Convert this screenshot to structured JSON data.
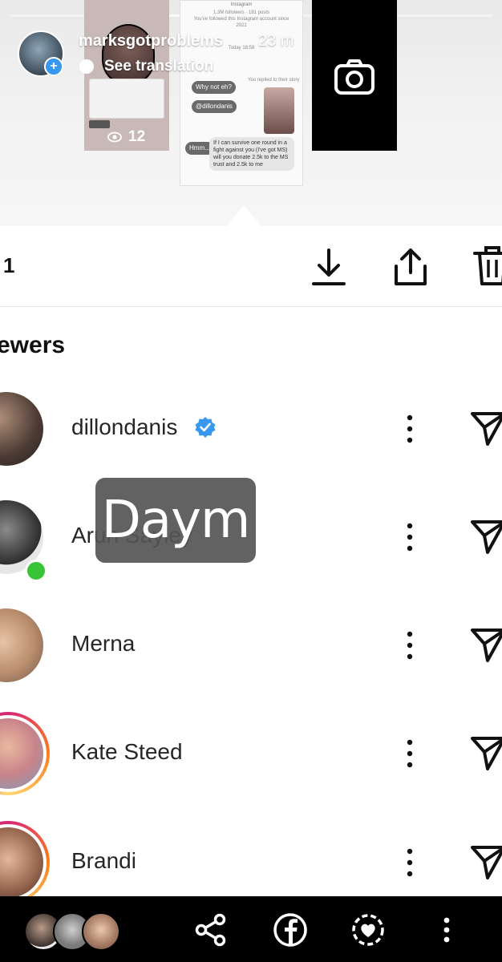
{
  "story": {
    "username": "marksgotproblems",
    "time": "23 m",
    "translate_label": "See translation",
    "view_count": "12",
    "thumb_text": {
      "header": "Instagram",
      "followers": "1.3M followers · 181 posts",
      "followed_since": "You've followed this Instagram account since",
      "year": "2022",
      "today": "Today 18:58",
      "reply_note": "You replied to their story",
      "why_not": "Why not eh?",
      "mention": "@dillondanis",
      "hmm": "Hmm...",
      "message": "If I can survive one round in a fight against you (I've got MS) will you donate 2.5k to the MS trust and 2.5k to me"
    }
  },
  "sheet": {
    "viewer_count": "1",
    "viewers_title": "ewers"
  },
  "viewers": [
    {
      "name": "dillondanis",
      "verified": true,
      "online": false,
      "story_ring": false
    },
    {
      "name": "Arun Sayley",
      "verified": false,
      "online": true,
      "story_ring": false
    },
    {
      "name": "Merna",
      "verified": false,
      "online": false,
      "story_ring": false
    },
    {
      "name": "Kate Steed",
      "verified": false,
      "online": false,
      "story_ring": true
    },
    {
      "name": "Brandi",
      "verified": false,
      "online": false,
      "story_ring": true
    }
  ],
  "overlay_sticker": "Daym",
  "icons": {
    "download": "download-icon",
    "share": "share-icon",
    "delete": "trash-icon",
    "more": "more-vertical-icon",
    "send": "send-icon",
    "bottom": [
      "share-nodes-icon",
      "facebook-icon",
      "close-friends-icon",
      "more-vertical-icon"
    ]
  },
  "colors": {
    "verified_blue": "#3897f0",
    "online_green": "#38c535",
    "ring_gradient": [
      "#d62976",
      "#fa7e1e",
      "#feda75",
      "#c13584"
    ]
  }
}
